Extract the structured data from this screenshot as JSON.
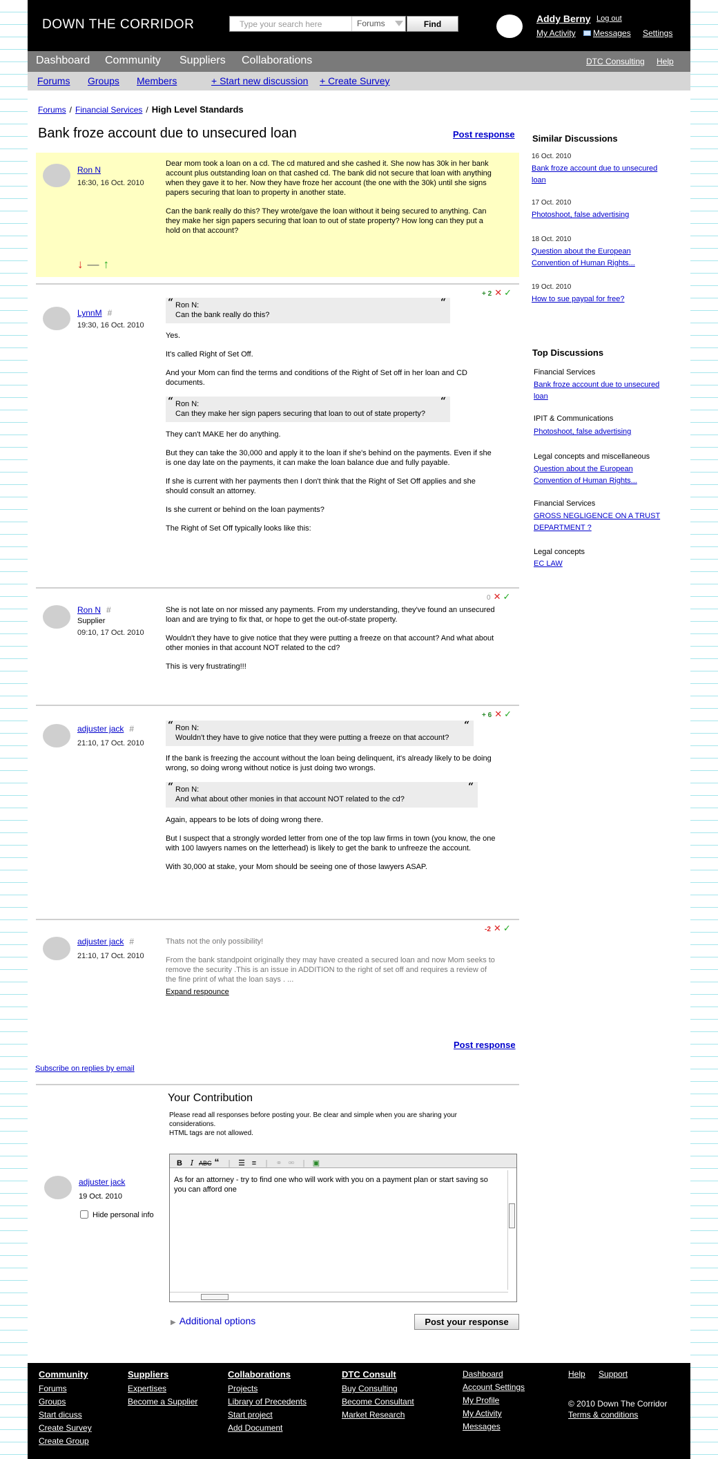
{
  "header": {
    "logo": "DOWN THE CORRIDOR",
    "search_placeholder": "Type your search here",
    "search_scope": "Forums",
    "find_label": "Find",
    "user_name": "Addy Berny",
    "logout": "Log out",
    "my_activity": "My Activity",
    "messages": "Messages",
    "settings": "Settings"
  },
  "mainnav": [
    "Dashboard",
    "Community",
    "Suppliers",
    "Collaborations"
  ],
  "utility": [
    "DTC Consulting",
    "Help"
  ],
  "subnav": [
    "Forums",
    "Groups",
    "Members",
    "+ Start new discussion",
    "+ Create Survey"
  ],
  "breadcrumb": [
    "Forums",
    "Financial Services",
    "High Level Standards"
  ],
  "title": "Bank froze account due to unsecured loan",
  "post_response": "Post response",
  "posts": [
    {
      "author": "Ron N",
      "time": "16:30, 16 Oct. 2010",
      "paragraphs": [
        "Dear mom took a loan on a cd. The cd matured and she cashed it. She now has 30k in her bank account plus outstanding loan on that cashed cd. The bank did not secure that loan with anything when they gave it to her. Now they have froze her account (the one with the 30k) until she signs papers securing that loan to property in another state.",
        "Can the bank really do this? They wrote/gave the loan without it being secured to anything. Can they make her sign papers securing that loan to out of state property? How long can they put a hold on that account?"
      ],
      "arrows": [
        "↓",
        "—",
        "↑"
      ]
    },
    {
      "author": "LynnM",
      "hash": "#",
      "time": "19:30, 16 Oct. 2010",
      "score": "+ 2",
      "quote1_author": "Ron N:",
      "quote1_text": "Can the bank really do this?",
      "p1": "Yes.",
      "p2": "It's called Right of Set Off.",
      "p3": "And your Mom can find the terms and conditions of the Right of Set off in her loan and CD documents.",
      "quote2_author": "Ron N:",
      "quote2_text": "Can they make her sign papers securing that loan to out of state property?",
      "p4": "They can't MAKE her do anything.",
      "p5": "But they can take the 30,000 and apply it to the loan if she's behind on the payments. Even if she is one day late on the payments, it can make the loan balance due and fully payable.",
      "p6": "If she is current with her payments then I don't think that the Right of Set Off applies and she should consult an attorney.",
      "p7": "Is she current or behind on the loan payments?",
      "p8": "The Right of Set Off typically looks like this:"
    },
    {
      "author": "Ron N",
      "hash": "#",
      "role": "Supplier",
      "time": "09:10, 17 Oct. 2010",
      "score": "0",
      "p1": "She is not late on nor missed any payments.  From my understanding, they've found an unsecured loan and are trying to fix that, or hope to get the out-of-state property.",
      "p2": "Wouldn't they have to give notice that they were putting a freeze on that account? And what about other monies in that account NOT related to the cd?",
      "p3": "This is very frustrating!!!"
    },
    {
      "author": "adjuster jack",
      "hash": "#",
      "time": "21:10, 17 Oct. 2010",
      "score": "+ 6",
      "quote1_author": "Ron N:",
      "quote1_text": "Wouldn't they have to give notice that they were putting a freeze on that account?",
      "p1": "If the bank is freezing the account without the loan being delinquent, it's already likely to be doing wrong, so doing wrong without notice is just doing two wrongs.",
      "quote2_author": "Ron N:",
      "quote2_text": "And what about other monies in that account NOT related to the cd?",
      "p2": "Again, appears to be lots of doing wrong there.",
      "p3": "But I suspect that a strongly worded letter from one of the top law firms in town (you know, the one with 100 lawyers names on the letterhead) is likely to get the bank to unfreeze the account.",
      "p4": "With 30,000 at stake, your Mom should be seeing one of those lawyers ASAP."
    },
    {
      "author": "adjuster jack",
      "hash": "#",
      "time": "21:10, 17 Oct. 2010",
      "score": "-2",
      "p1": "Thats not the only possibility!",
      "p2": "From the bank standpoint originally they may have created a secured loan and now Mom seeks to remove the security .This is an issue in ADDITION to the right of set off and requires a review of the fine print of what the loan says . ...",
      "expand": "Expand respounce"
    }
  ],
  "sidebar": {
    "similar_title": "Similar Discussions",
    "similar": [
      {
        "date": "16 Oct. 2010",
        "title": "Bank froze account due to unsecured loan"
      },
      {
        "date": "17 Oct. 2010",
        "title": "Photoshoot, false advertising"
      },
      {
        "date": "18 Oct. 2010",
        "title": "Question about the European Convention of Human Rights..."
      },
      {
        "date": "19 Oct. 2010",
        "title": "How to sue paypal for free?"
      }
    ],
    "top_title": "Top Discussions",
    "top": [
      {
        "category": "Financial Services",
        "title": "Bank froze account due to unsecured loan"
      },
      {
        "category": "IPIT & Communications",
        "title": "Photoshoot, false advertising"
      },
      {
        "category": "Legal concepts and miscellaneous",
        "title": "Question about the European Convention of Human Rights..."
      },
      {
        "category": "Financial Services",
        "title": "GROSS NEGLIGENCE ON A TRUST DEPARTMENT ?"
      },
      {
        "category": "Legal concepts",
        "title": "EC LAW"
      }
    ]
  },
  "subscribe": "Subscribe on replies by email",
  "contribution": {
    "title": "Your Contribution",
    "note_line1": "Please read all responses before posting your. Be clear and simple when you are sharing your considerations.",
    "note_line2": "HTML tags are not allowed.",
    "author": "adjuster jack",
    "date": "19 Oct. 2010",
    "hide_label": "Hide personal info",
    "editor_text": "As for an attorney - try to find one who will work with you on a payment plan or start saving so you can afford one",
    "additional": "Additional options",
    "submit": "Post your response"
  },
  "footer": {
    "community": {
      "head": "Community",
      "links": [
        "Forums",
        "Groups",
        "Start dicuss",
        "Create Survey",
        "Create Group"
      ]
    },
    "suppliers": {
      "head": "Suppliers",
      "links": [
        "Expertises",
        "Become a Supplier"
      ]
    },
    "collaborations": {
      "head": "Collaborations",
      "links": [
        "Projects",
        "Library of Precedents",
        "Start project",
        "Add Document"
      ]
    },
    "dtc": {
      "head": "DTC Consult",
      "links": [
        "Buy Consulting",
        "Become Consultant",
        "Market Research"
      ]
    },
    "account": {
      "links": [
        "Dashboard",
        "Account Settings",
        "My Profile",
        "My Activity",
        "Messages"
      ]
    },
    "help": {
      "links": [
        "Help",
        "Support"
      ]
    },
    "copyright": "© 2010 Down The Corridor",
    "terms": "Terms & conditions"
  }
}
